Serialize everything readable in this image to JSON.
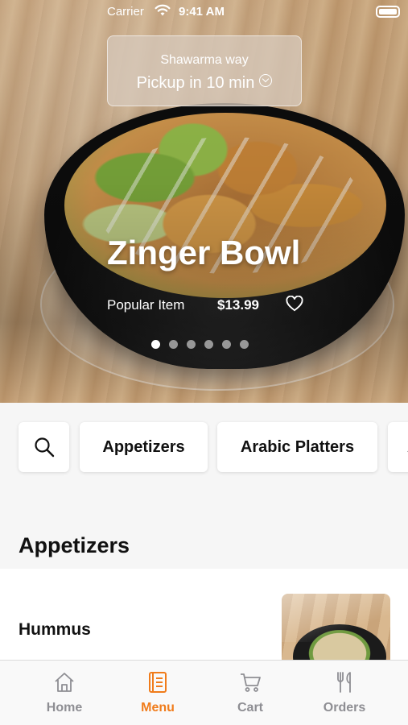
{
  "status_bar": {
    "carrier": "Carrier",
    "time": "9:41 AM"
  },
  "pickup": {
    "store_name": "Shawarma way",
    "eta": "Pickup in 10 min"
  },
  "hero": {
    "title": "Zinger Bowl",
    "tag": "Popular Item",
    "price": "$13.99",
    "slide_count": 6,
    "active_slide": 1
  },
  "categories": {
    "search_icon": "search-icon",
    "items": [
      "Appetizers",
      "Arabic Platters",
      "A"
    ]
  },
  "section": {
    "title": "Appetizers"
  },
  "menu_items": [
    {
      "name": "Hummus"
    }
  ],
  "tabbar": {
    "tabs": [
      {
        "label": "Home",
        "icon": "home-icon"
      },
      {
        "label": "Menu",
        "icon": "menu-icon",
        "active": true
      },
      {
        "label": "Cart",
        "icon": "cart-icon"
      },
      {
        "label": "Orders",
        "icon": "fork-knife-icon"
      }
    ]
  },
  "colors": {
    "accent": "#f07c1b",
    "inactive_tab": "#8e8e93"
  }
}
